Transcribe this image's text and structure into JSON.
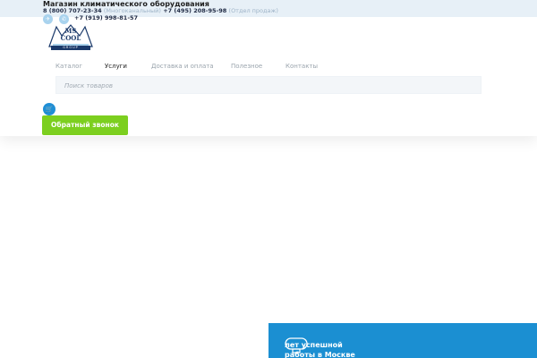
{
  "header": {
    "shop_title": "Магазин климатического оборудования",
    "phone1": "8 (800) 707-23-34",
    "phone1_note": "(Многоканальный)",
    "phone2": "+7 (495) 208-95-98",
    "phone2_note": "(Отдел продаж)",
    "phone3": "+7 (919) 998-81-57",
    "social": [
      {
        "icon": "telegram-icon",
        "glyph": "✈"
      },
      {
        "icon": "whatsapp-icon",
        "glyph": "✆"
      }
    ]
  },
  "logo": {
    "line1": "MS",
    "line2": "COOL",
    "line3": "GROUP"
  },
  "nav": {
    "items": [
      {
        "label": "Каталог",
        "active": false
      },
      {
        "label": "Услуги",
        "active": true
      },
      {
        "label": "Доставка и оплата",
        "active": false
      },
      {
        "label": "Полезное",
        "active": false
      },
      {
        "label": "Контакты",
        "active": false
      }
    ]
  },
  "search": {
    "placeholder": "Поиск товаров"
  },
  "cart": {
    "icon": "cart-icon",
    "glyph": "🛒"
  },
  "callback": {
    "label": "Обратный звонок"
  },
  "promo": {
    "line1": "лет успешной",
    "line2": "работы в Москве"
  },
  "colors": {
    "topbar": "#e7f0f7",
    "accent_blue": "#1b8fd2",
    "accent_green": "#7ccf1f",
    "nav_text": "#9aa4ad"
  }
}
